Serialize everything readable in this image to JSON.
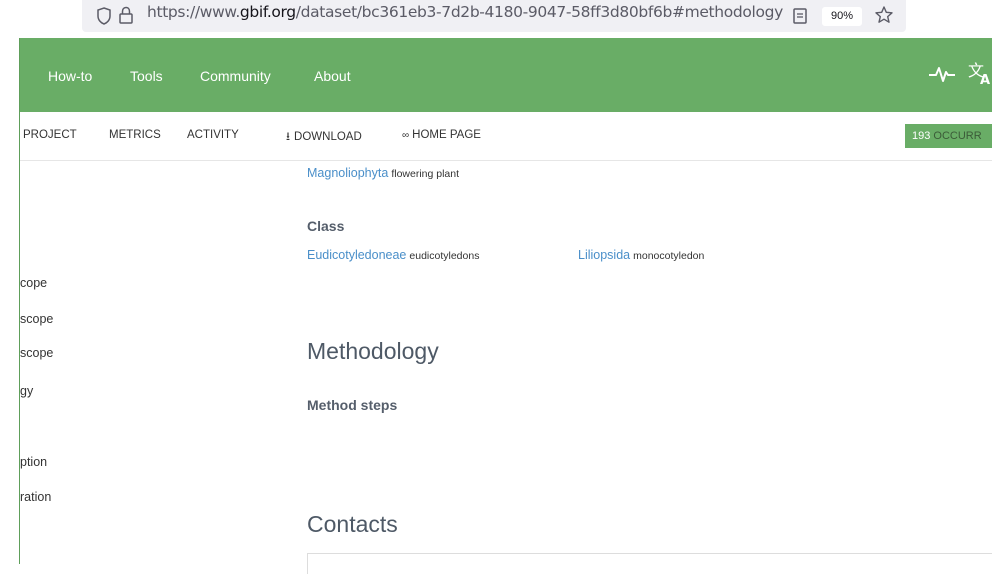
{
  "browser": {
    "url_prefix": "https://www.",
    "url_domain": "gbif.org",
    "url_path": "/dataset/bc361eb3-7d2b-4180-9047-58ff3d80bf6b#methodology",
    "zoom": "90%"
  },
  "nav": {
    "items": [
      "How-to",
      "Tools",
      "Community",
      "About"
    ]
  },
  "subnav": {
    "project": "PROJECT",
    "metrics": "METRICS",
    "activity": "ACTIVITY",
    "download": "DOWNLOAD",
    "homepage": "HOME PAGE",
    "occ_count": "193",
    "occ_label": "OCCURR"
  },
  "sidebar": {
    "items": [
      "cope",
      "scope",
      "scope",
      "gy",
      "ption",
      "ration"
    ]
  },
  "content": {
    "division_name": "Magnoliophyta",
    "division_common": "flowering plant",
    "class_heading": "Class",
    "class1_name": "Eudicotyledoneae",
    "class1_common": "eudicotyledons",
    "class2_name": "Liliopsida",
    "class2_common": "monocotyledon",
    "methodology_heading": "Methodology",
    "method_steps": "Method steps",
    "contacts_heading": "Contacts"
  },
  "colors": {
    "brand_green": "#69ad66",
    "link_blue": "#4a8fc9"
  }
}
